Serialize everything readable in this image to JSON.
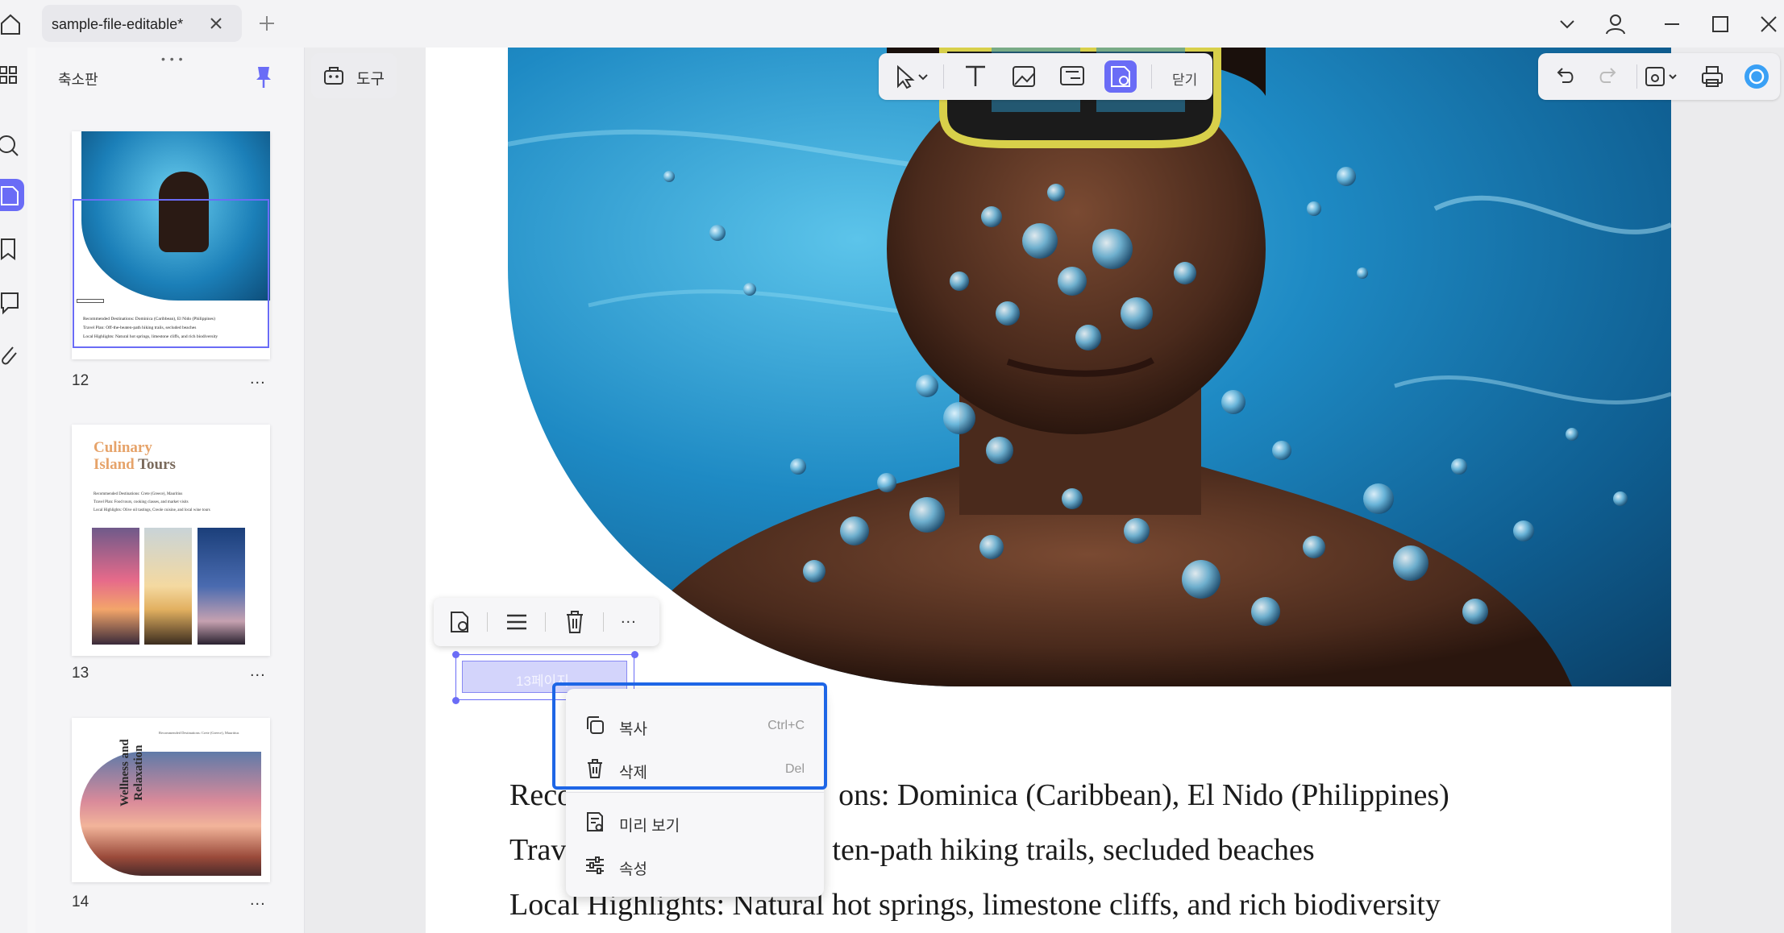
{
  "window": {
    "tab_title": "sample-file-editable*",
    "colors": {
      "accent": "#6a6cf6",
      "highlight": "#1e66e6"
    }
  },
  "thumbnails": {
    "title": "축소판",
    "pages": [
      {
        "number": "12",
        "more": "...",
        "text_lines": [
          "Recommended Destinations: Dominica (Caribbean), El Nido (Philippines)",
          "Travel Plan: Off-the-beaten-path hiking trails, secluded beaches",
          "Local Highlights: Natural hot springs, limestone cliffs, and rich biodiversity"
        ]
      },
      {
        "number": "13",
        "more": "...",
        "heading_1": "Culinary",
        "heading_2a": "Island",
        "heading_2b": "Tours",
        "text_lines": [
          "Recommended Destinations: Crete (Greece), Mauritius",
          "Travel Plan: Food tours, cooking classes, and market visits",
          "Local Highlights: Olive oil tastings, Creole cuisine, and local wine tours"
        ]
      },
      {
        "number": "14",
        "more": "...",
        "header_line": "Recommended Destinations: Crete (Greece), Mauritius",
        "vertical_title_1": "Wellness and",
        "vertical_title_2": "Relaxation"
      }
    ]
  },
  "tools": {
    "label": "도구"
  },
  "edit_toolbar": {
    "close_label": "닫기",
    "icons": [
      "select-arrow-icon",
      "text-icon",
      "image-icon",
      "link-icon",
      "form-field-icon"
    ]
  },
  "right_toolbar": {
    "icons": [
      "undo-icon",
      "redo-icon",
      "save-icon",
      "print-icon",
      "ai-assistant-icon"
    ]
  },
  "mini_toolbar": {
    "icons": [
      "field-properties-icon",
      "align-icon",
      "delete-icon",
      "more-icon"
    ],
    "more_label": "..."
  },
  "form_field": {
    "text": "13페이지"
  },
  "context_menu": {
    "items": [
      {
        "label": "복사",
        "shortcut": "Ctrl+C",
        "icon": "copy-icon"
      },
      {
        "label": "삭제",
        "shortcut": "Del",
        "icon": "trash-icon"
      },
      {
        "label": "미리 보기",
        "shortcut": "",
        "icon": "preview-icon"
      },
      {
        "label": "속성",
        "shortcut": "",
        "icon": "properties-icon"
      }
    ]
  },
  "document": {
    "line_1_prefix": "Reco",
    "line_1_suffix": "ons: Dominica (Caribbean), El Nido (Philippines)",
    "line_2_prefix": "Trav",
    "line_2_suffix": "ten-path hiking trails, secluded beaches",
    "line_3": "Local Highlights: Natural hot springs, limestone cliffs, and rich biodiversity"
  }
}
